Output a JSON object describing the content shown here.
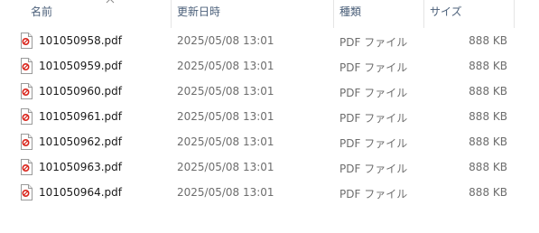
{
  "columns": {
    "name": "名前",
    "date": "更新日時",
    "type": "種類",
    "size": "サイズ"
  },
  "sort": {
    "column": "name",
    "direction": "ascending",
    "icon": "sort-up-arrow-icon"
  },
  "files": [
    {
      "name": "101050958.pdf",
      "date": "2025/05/08 13:01",
      "type": "PDF ファイル",
      "size": "888 KB",
      "icon": "pdf-file-icon"
    },
    {
      "name": "101050959.pdf",
      "date": "2025/05/08 13:01",
      "type": "PDF ファイル",
      "size": "888 KB",
      "icon": "pdf-file-icon"
    },
    {
      "name": "101050960.pdf",
      "date": "2025/05/08 13:01",
      "type": "PDF ファイル",
      "size": "888 KB",
      "icon": "pdf-file-icon"
    },
    {
      "name": "101050961.pdf",
      "date": "2025/05/08 13:01",
      "type": "PDF ファイル",
      "size": "888 KB",
      "icon": "pdf-file-icon"
    },
    {
      "name": "101050962.pdf",
      "date": "2025/05/08 13:01",
      "type": "PDF ファイル",
      "size": "888 KB",
      "icon": "pdf-file-icon"
    },
    {
      "name": "101050963.pdf",
      "date": "2025/05/08 13:01",
      "type": "PDF ファイル",
      "size": "888 KB",
      "icon": "pdf-file-icon"
    },
    {
      "name": "101050964.pdf",
      "date": "2025/05/08 13:01",
      "type": "PDF ファイル",
      "size": "888 KB",
      "icon": "pdf-file-icon"
    }
  ],
  "colors": {
    "header_text": "#4c607a",
    "name_text": "#1a1a1a",
    "meta_text": "#6d6d6d",
    "pdf_red": "#d9251c"
  }
}
